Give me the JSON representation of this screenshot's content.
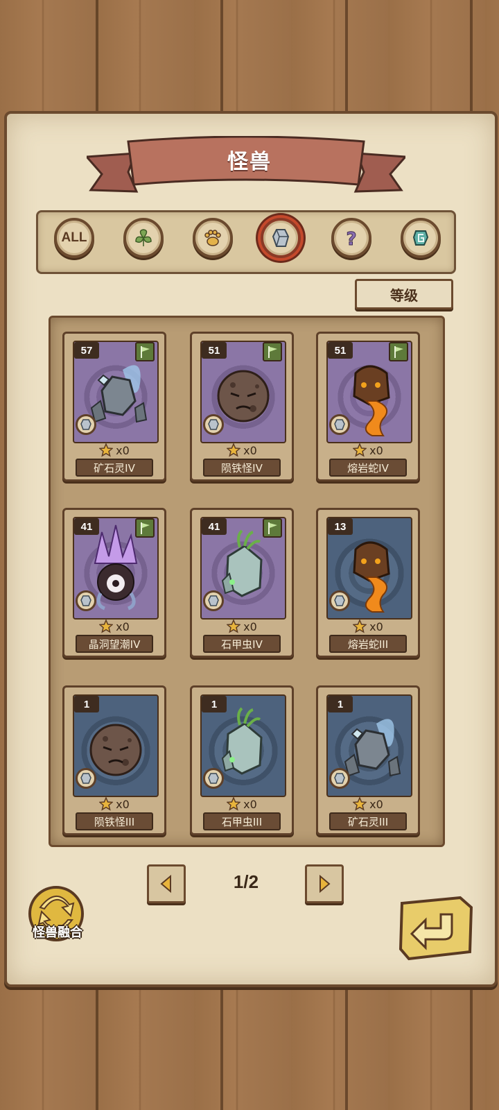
{
  "header": {
    "title": "怪兽"
  },
  "filters": [
    {
      "label": "ALL",
      "icon": "all-icon",
      "active": false
    },
    {
      "label": "",
      "icon": "leaf-icon",
      "active": false
    },
    {
      "label": "",
      "icon": "paw-icon",
      "active": false
    },
    {
      "label": "",
      "icon": "crystal-icon",
      "active": true
    },
    {
      "label": "",
      "icon": "question-icon",
      "active": false
    },
    {
      "label": "",
      "icon": "rune-icon",
      "active": false
    }
  ],
  "sort": {
    "label": "等级"
  },
  "cards": [
    {
      "level": "57",
      "count": "x0",
      "name": "矿石灵IV",
      "bg": "purple",
      "flag": true,
      "creature": "ore-spirit"
    },
    {
      "level": "51",
      "count": "x0",
      "name": "陨铁怪IV",
      "bg": "purple",
      "flag": true,
      "creature": "meteorite"
    },
    {
      "level": "51",
      "count": "x0",
      "name": "熔岩蛇IV",
      "bg": "purple",
      "flag": true,
      "creature": "lava-snake"
    },
    {
      "level": "41",
      "count": "x0",
      "name": "晶洞望潮IV",
      "bg": "purple",
      "flag": true,
      "creature": "crystal-octopus"
    },
    {
      "level": "41",
      "count": "x0",
      "name": "石甲虫IV",
      "bg": "purple",
      "flag": true,
      "creature": "stone-beetle"
    },
    {
      "level": "13",
      "count": "x0",
      "name": "熔岩蛇III",
      "bg": "blue",
      "flag": false,
      "creature": "lava-snake"
    },
    {
      "level": "1",
      "count": "x0",
      "name": "陨铁怪III",
      "bg": "blue",
      "flag": false,
      "creature": "meteorite"
    },
    {
      "level": "1",
      "count": "x0",
      "name": "石甲虫III",
      "bg": "blue",
      "flag": false,
      "creature": "stone-beetle"
    },
    {
      "level": "1",
      "count": "x0",
      "name": "矿石灵III",
      "bg": "blue",
      "flag": false,
      "creature": "ore-spirit"
    }
  ],
  "pager": {
    "text": "1/2"
  },
  "fusion": {
    "label": "怪兽融合"
  },
  "colors": {
    "accent": "#c4492c",
    "banner": "#b56f5f",
    "panel": "#ece0c4"
  }
}
